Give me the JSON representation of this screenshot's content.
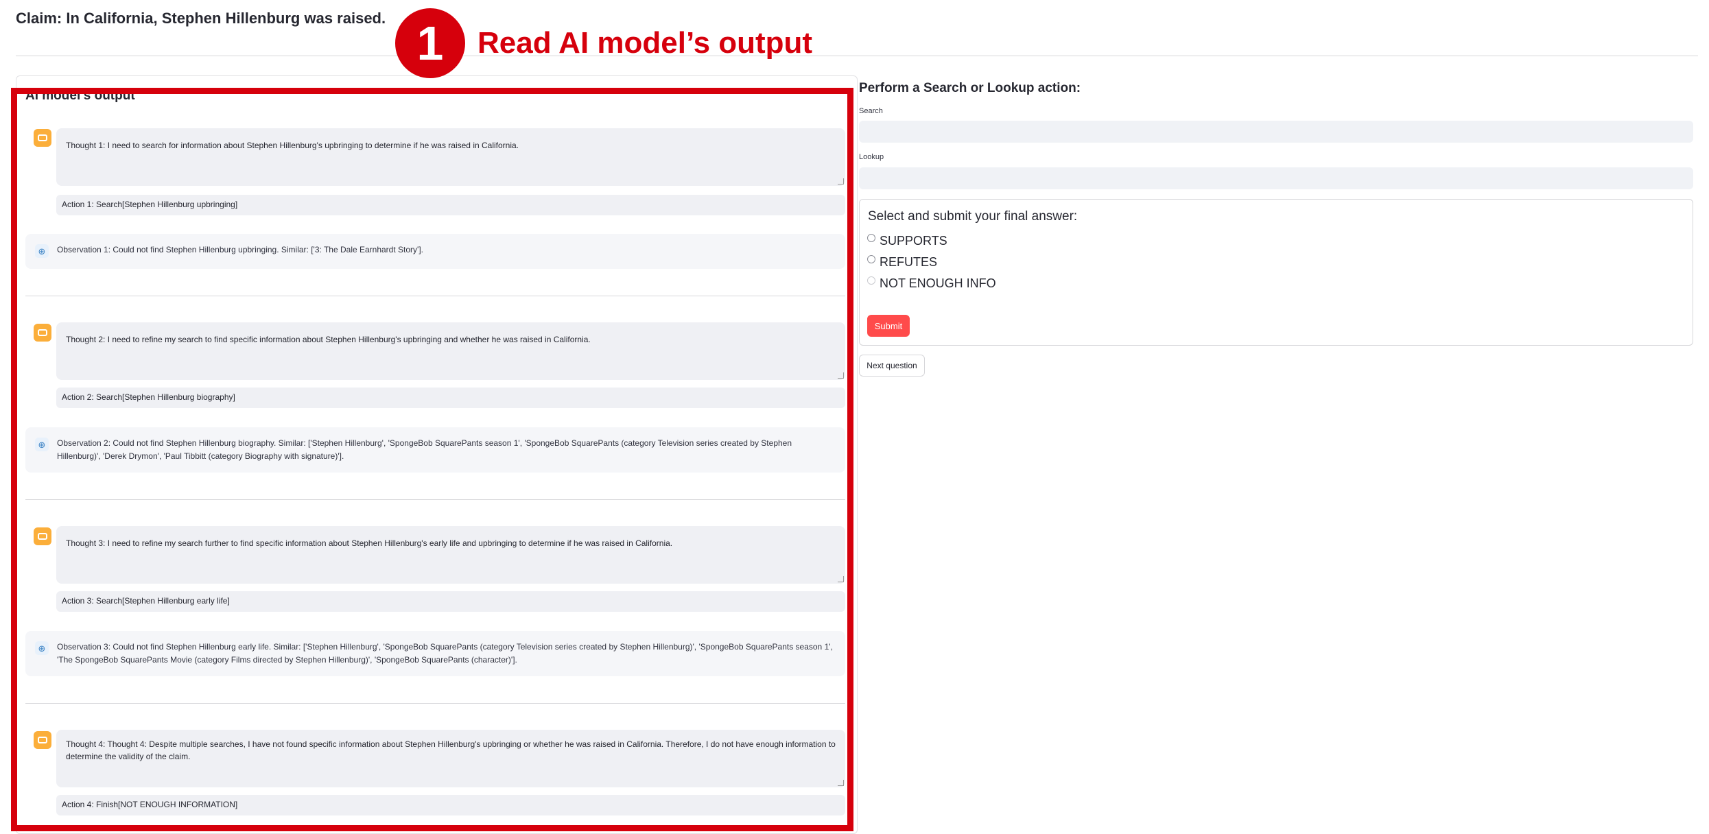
{
  "claim": "Claim: In California, Stephen Hillenburg was raised.",
  "annotation": {
    "number": "1",
    "text": "Read AI model’s output",
    "color": "#d6000c"
  },
  "output_panel": {
    "title": "AI model's output",
    "steps": [
      {
        "thought": "Thought 1: I need to search for information about Stephen Hillenburg's upbringing to determine if he was raised in California.",
        "action": "Action 1: Search[Stephen Hillenburg upbringing]",
        "observation": "Observation 1: Could not find Stephen Hillenburg upbringing. Similar: ['3: The Dale Earnhardt Story']."
      },
      {
        "thought": "Thought 2: I need to refine my search to find specific information about Stephen Hillenburg's upbringing and whether he was raised in California.",
        "action": "Action 2: Search[Stephen Hillenburg biography]",
        "observation": "Observation 2: Could not find Stephen Hillenburg biography. Similar: ['Stephen Hillenburg', 'SpongeBob SquarePants season 1', 'SpongeBob SquarePants (category Television series created by Stephen Hillenburg)', 'Derek Drymon', 'Paul Tibbitt (category Biography with signature)']."
      },
      {
        "thought": "Thought 3: I need to refine my search further to find specific information about Stephen Hillenburg's early life and upbringing to determine if he was raised in California.",
        "action": "Action 3: Search[Stephen Hillenburg early life]",
        "observation": "Observation 3: Could not find Stephen Hillenburg early life. Similar: ['Stephen Hillenburg', 'SpongeBob SquarePants (category Television series created by Stephen Hillenburg)', 'SpongeBob SquarePants season 1', 'The SpongeBob SquarePants Movie (category Films directed by Stephen Hillenburg)', 'SpongeBob SquarePants (character)']."
      },
      {
        "thought": "Thought 4: Thought 4: Despite multiple searches, I have not found specific information about Stephen Hillenburg's upbringing or whether he was raised in California. Therefore, I do not have enough information to determine the validity of the claim.",
        "action": "Action 4: Finish[NOT ENOUGH INFORMATION]"
      }
    ]
  },
  "actions_panel": {
    "title": "Perform a Search or Lookup action:",
    "search_label": "Search",
    "search_value": "",
    "lookup_label": "Lookup",
    "lookup_value": ""
  },
  "answer_form": {
    "title": "Select and submit your final answer:",
    "options": [
      "SUPPORTS",
      "REFUTES",
      "NOT ENOUGH INFO"
    ],
    "submit_label": "Submit"
  },
  "next_label": "Next question",
  "colors": {
    "accent": "#ff4b4b",
    "bot_icon": "#fbae3a",
    "annotation_red": "#d6000c"
  }
}
